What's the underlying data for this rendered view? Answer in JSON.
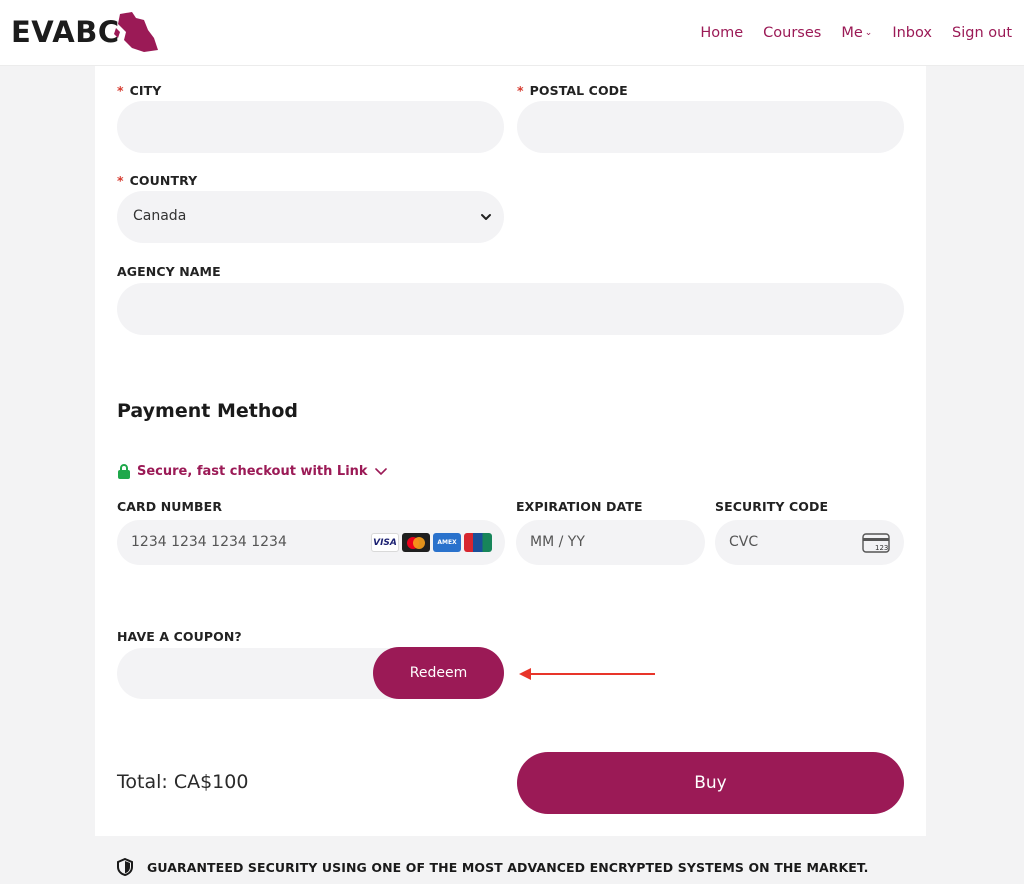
{
  "header": {
    "logo_text": "EVABC",
    "nav": {
      "home": "Home",
      "courses": "Courses",
      "me": "Me",
      "inbox": "Inbox",
      "sign_out": "Sign out"
    }
  },
  "form": {
    "city": {
      "label": "CITY",
      "value": ""
    },
    "postal_code": {
      "label": "POSTAL CODE",
      "value": ""
    },
    "country": {
      "label": "COUNTRY",
      "selected": "Canada"
    },
    "agency_name": {
      "label": "AGENCY NAME",
      "value": ""
    },
    "required_mark": "*"
  },
  "payment": {
    "title": "Payment Method",
    "link_checkout": "Secure, fast checkout with Link",
    "card_number": {
      "label": "CARD NUMBER",
      "placeholder": "1234 1234 1234 1234"
    },
    "expiration": {
      "label": "EXPIRATION DATE",
      "placeholder": "MM / YY"
    },
    "security_code": {
      "label": "SECURITY CODE",
      "placeholder": "CVC",
      "card_icon_text": "123"
    },
    "brands": [
      "VISA",
      "mastercard",
      "AMEX",
      "UnionPay"
    ]
  },
  "coupon": {
    "label": "HAVE A COUPON?",
    "value": "",
    "redeem_label": "Redeem"
  },
  "checkout": {
    "total": "Total: CA$100",
    "buy_label": "Buy"
  },
  "footer": {
    "security_note": "GUARANTEED SECURITY USING ONE OF THE MOST ADVANCED ENCRYPTED SYSTEMS ON THE MARKET."
  },
  "colors": {
    "accent": "#9b1a56",
    "required": "#d63a2f",
    "field_bg": "#f3f3f5",
    "lock_green": "#1fa84b",
    "annotation_arrow": "#e8352a"
  }
}
